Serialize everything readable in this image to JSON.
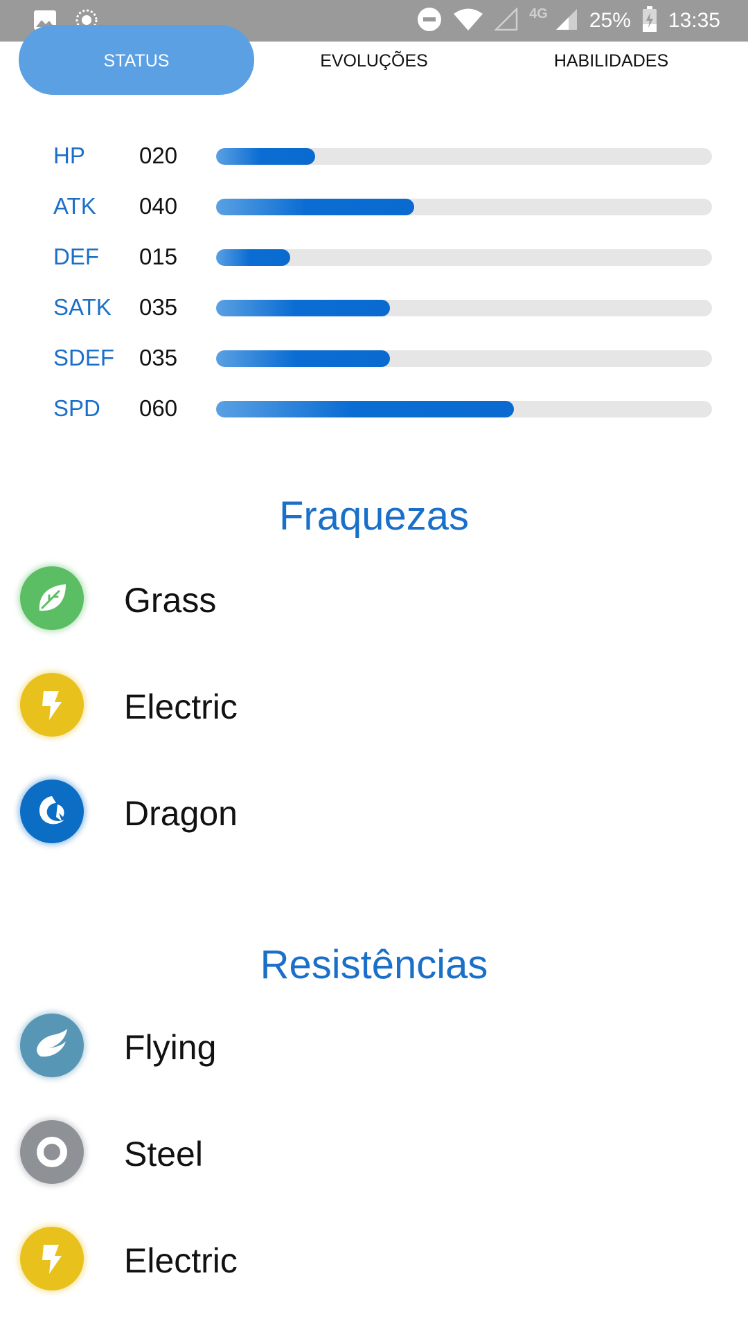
{
  "status_bar": {
    "time": "13:35",
    "battery_percent": "25%",
    "network": "4G",
    "icons": [
      "image-icon",
      "sync-icon",
      "do-not-disturb-icon",
      "wifi-icon",
      "signal-empty-icon",
      "signal-icon",
      "battery-icon"
    ]
  },
  "tabs": [
    {
      "label": "STATUS",
      "active": true
    },
    {
      "label": "EVOLUÇÕES",
      "active": false
    },
    {
      "label": "HABILIDADES",
      "active": false
    }
  ],
  "stats": [
    {
      "name": "HP",
      "value": "020",
      "fill_fraction": 0.2
    },
    {
      "name": "ATK",
      "value": "040",
      "fill_fraction": 0.4
    },
    {
      "name": "DEF",
      "value": "015",
      "fill_fraction": 0.15
    },
    {
      "name": "SATK",
      "value": "035",
      "fill_fraction": 0.35
    },
    {
      "name": "SDEF",
      "value": "035",
      "fill_fraction": 0.35
    },
    {
      "name": "SPD",
      "value": "060",
      "fill_fraction": 0.6
    }
  ],
  "weaknesses": {
    "title": "Fraquezas",
    "items": [
      {
        "name": "Grass",
        "icon": "grass-icon",
        "color": "#5cbe64"
      },
      {
        "name": "Electric",
        "icon": "electric-icon",
        "color": "#e8c11d"
      },
      {
        "name": "Dragon",
        "icon": "dragon-icon",
        "color": "#0b6dc4"
      }
    ]
  },
  "resistances": {
    "title": "Resistências",
    "items": [
      {
        "name": "Flying",
        "icon": "flying-icon",
        "color": "#5896b5"
      },
      {
        "name": "Steel",
        "icon": "steel-icon",
        "color": "#8e9195"
      },
      {
        "name": "Electric",
        "icon": "electric-icon",
        "color": "#e8c11d"
      }
    ]
  }
}
